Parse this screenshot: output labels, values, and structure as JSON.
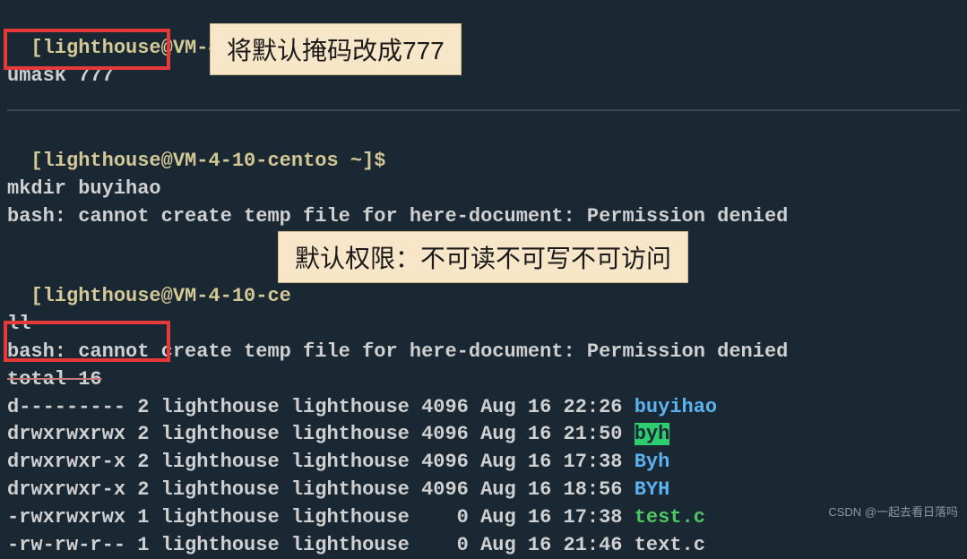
{
  "prompt": {
    "user": "lighthouse",
    "host": "VM-4-10-centos",
    "path": "~",
    "open_bracket": "[",
    "close_bracket": "]",
    "at": "@",
    "dollar": "$"
  },
  "block1": {
    "command": "umask 777"
  },
  "annotation1": "将默认掩码改成777",
  "block2": {
    "command": "mkdir buyihao",
    "error": "bash: cannot create temp file for here-document: Permission denied"
  },
  "block3": {
    "prompt_partial_host": "VM-4-10-ce",
    "command": "ll",
    "error": "bash: cannot create temp file for here-document: Permission denied",
    "total_line": "total 16"
  },
  "annotation2": "默认权限：不可读不可写不可访问",
  "listing": [
    {
      "perms": "d---------",
      "links": "2",
      "owner": "lighthouse",
      "group": "lighthouse",
      "size": "4096",
      "date": "Aug 16 22:26",
      "name": "buyihao",
      "class": "dir-blue"
    },
    {
      "perms": "drwxrwxrwx",
      "links": "2",
      "owner": "lighthouse",
      "group": "lighthouse",
      "size": "4096",
      "date": "Aug 16 21:50",
      "name": "byh",
      "class": "highlight-green"
    },
    {
      "perms": "drwxrwxr-x",
      "links": "2",
      "owner": "lighthouse",
      "group": "lighthouse",
      "size": "4096",
      "date": "Aug 16 17:38",
      "name": "Byh",
      "class": "dir-blue"
    },
    {
      "perms": "drwxrwxr-x",
      "links": "2",
      "owner": "lighthouse",
      "group": "lighthouse",
      "size": "4096",
      "date": "Aug 16 18:56",
      "name": "BYH",
      "class": "dir-blue"
    },
    {
      "perms": "-rwxrwxrwx",
      "links": "1",
      "owner": "lighthouse",
      "group": "lighthouse",
      "size": "   0",
      "date": "Aug 16 17:38",
      "name": "test.c",
      "class": "exec-green"
    },
    {
      "perms": "-rw-rw-r--",
      "links": "1",
      "owner": "lighthouse",
      "group": "lighthouse",
      "size": "   0",
      "date": "Aug 16 21:46",
      "name": "text.c",
      "class": "file-plain"
    }
  ],
  "watermark": "CSDN @一起去看日落吗"
}
